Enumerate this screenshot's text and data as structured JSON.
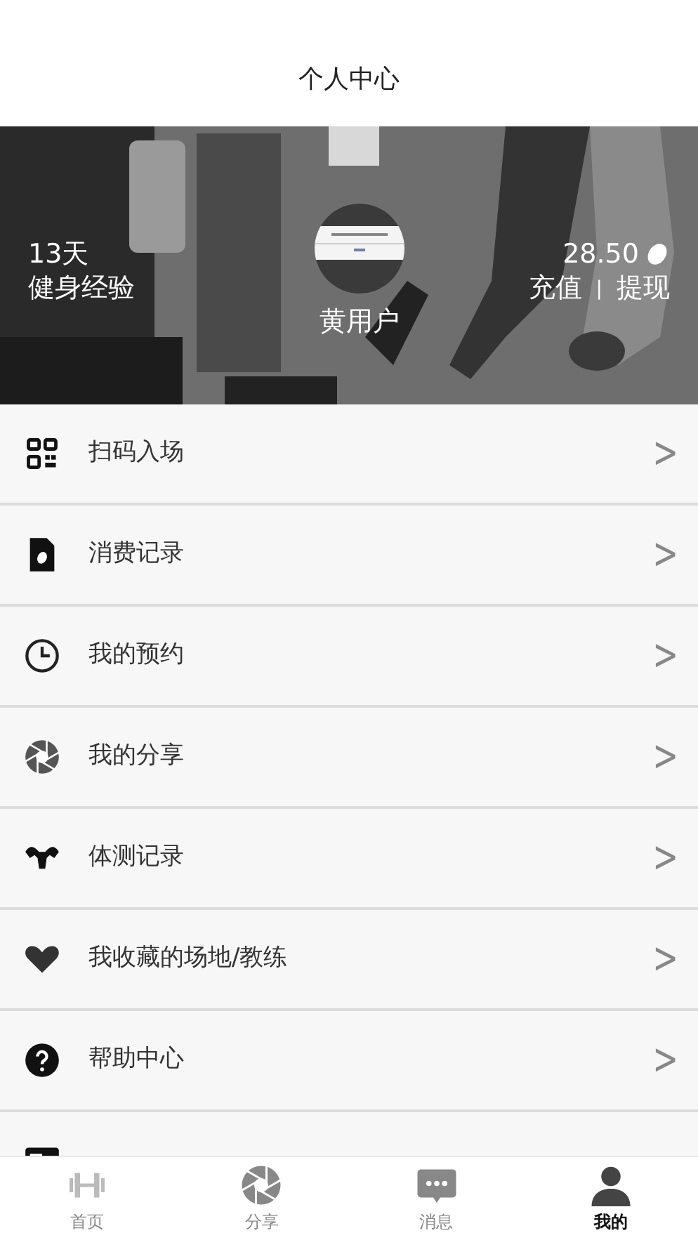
{
  "header": {
    "title": "个人中心"
  },
  "banner": {
    "days": "13天",
    "days_label": "健身经验",
    "user_name": "黄用户",
    "balance": "28.50",
    "recharge": "充值",
    "separator": "|",
    "withdraw": "提现"
  },
  "menu": [
    {
      "kind": "qr",
      "label": "扫码入场",
      "chevron": ">"
    },
    {
      "kind": "bill",
      "label": "消费记录",
      "chevron": ">"
    },
    {
      "kind": "clock",
      "label": "我的预约",
      "chevron": ">"
    },
    {
      "kind": "aperture",
      "label": "我的分享",
      "chevron": ">"
    },
    {
      "kind": "muscle",
      "label": "体测记录",
      "chevron": ">"
    },
    {
      "kind": "heart",
      "label": "我收藏的场地/教练",
      "chevron": ">"
    },
    {
      "kind": "help",
      "label": "帮助中心",
      "chevron": ">"
    },
    {
      "kind": "card"
    }
  ],
  "tab_bar": [
    {
      "kind": "dumbbell",
      "label": "首页",
      "selected": false
    },
    {
      "kind": "aperture",
      "label": "分享",
      "selected": false
    },
    {
      "kind": "chat",
      "label": "消息",
      "selected": false
    },
    {
      "kind": "person",
      "label": "我的",
      "selected": true
    }
  ]
}
